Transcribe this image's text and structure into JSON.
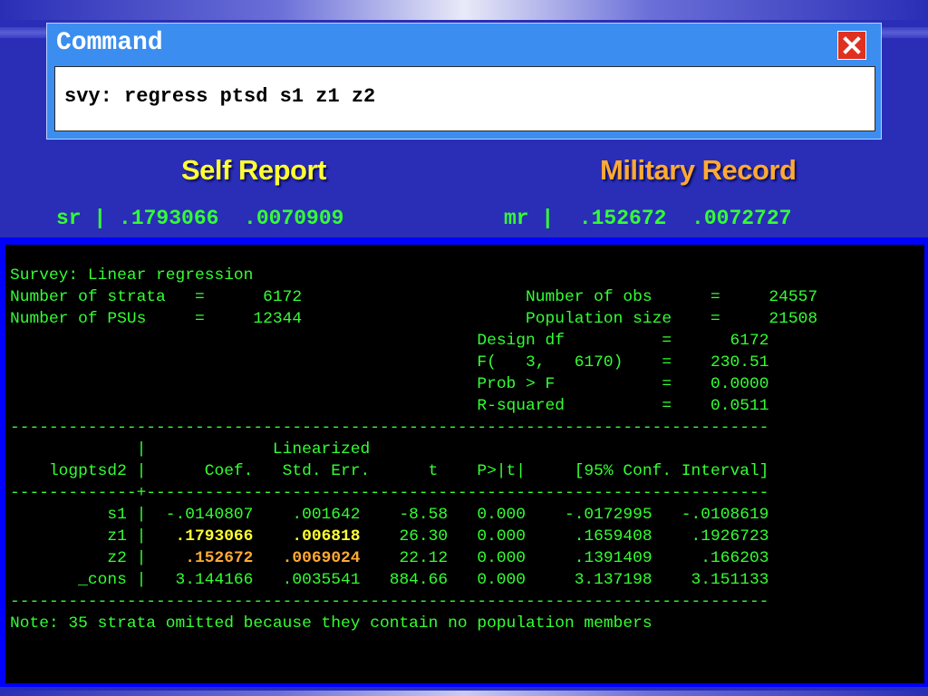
{
  "command_window": {
    "title": "Command",
    "command": "svy: regress ptsd s1 z1 z2"
  },
  "labels": {
    "self_report": "Self Report",
    "military_record": "Military Record"
  },
  "summary": {
    "sr_line": "sr | .1793066  .0070909",
    "mr_line": "mr |  .152672  .0072727"
  },
  "results": {
    "header": {
      "title": "Survey: Linear regression",
      "strata": "Number of strata   =      6172",
      "psus": "Number of PSUs     =     12344",
      "obs": "Number of obs      =     24557",
      "popsize": "Population size    =     21508",
      "design_df": "Design df          =      6172",
      "f": "F(   3,   6170)    =    230.51",
      "prob_f": "Prob > F           =    0.0000",
      "r2": "R-squared          =    0.0511"
    },
    "separator": "------------------------------------------------------------------------------",
    "col_header_1": "             |             Linearized",
    "col_header_2": "    logptsd2 |      Coef.   Std. Err.      t    P>|t|     [95% Conf. Interval]",
    "separator_mid": "-------------+----------------------------------------------------------------",
    "rows": {
      "s1": "          s1 |  -.0140807    .001642    -8.58   0.000    -.0172995   -.0108619",
      "z1_prefix": "          z1 |   ",
      "z1_coef": ".1793066",
      "z1_gap": "    ",
      "z1_se": ".006818",
      "z1_rest": "    26.30   0.000     .1659408    .1926723",
      "z2_prefix": "          z2 |    ",
      "z2_coef": ".152672",
      "z2_gap": "   ",
      "z2_se": ".0069024",
      "z2_rest": "    22.12   0.000     .1391409     .166203",
      "cons": "       _cons |   3.144166   .0035541   884.66   0.000     3.137198    3.151133"
    },
    "note": "Note: 35 strata omitted because they contain no population members"
  },
  "colors": {
    "background": "#2a2eb6",
    "results_text": "#33ff33",
    "self_report": "#ffff33",
    "military_record": "#ffaa33",
    "title_bar": "#3b8ef0",
    "close": "#e03020"
  },
  "icons": {
    "close": "close-icon"
  }
}
